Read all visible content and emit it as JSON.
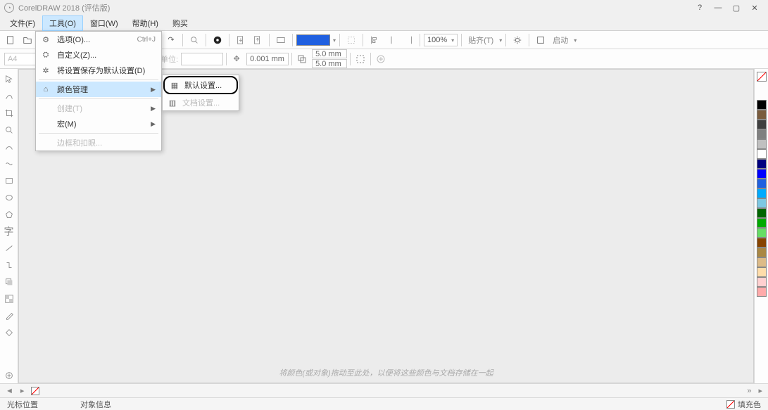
{
  "title": "CorelDRAW 2018 (评估版)",
  "menubar": {
    "items": [
      "文件(F)",
      "工具(O)",
      "窗口(W)",
      "帮助(H)",
      "购买"
    ],
    "open_index": 1
  },
  "dropdown": {
    "options": {
      "label": "选项(O)...",
      "shortcut": "Ctrl+J"
    },
    "customize": "自定义(Z)...",
    "save_defaults": "将设置保存为默认设置(D)",
    "color_mgmt": "颜色管理",
    "create": "创建(T)",
    "macro": "宏(M)",
    "border_and": "边框和扣眼..."
  },
  "submenu": {
    "default_settings": "默认设置...",
    "doc_settings": "文档设置..."
  },
  "toolbar": {
    "pct": "100%",
    "launch": "启动"
  },
  "propbar": {
    "page": "A4",
    "unit_label": "单位:",
    "nudge": "0.001 mm",
    "dup_x": "5.0 mm",
    "dup_y": "5.0 mm"
  },
  "hint": "将颜色(或对象)拖动至此处，以便将这些颜色与文档存储在一起",
  "statusbar": {
    "cursor_pos": "光标位置",
    "obj_info": "对象信息",
    "fill": "填充色"
  },
  "palette_colors": [
    "#000000",
    "#7a5c3e",
    "#404040",
    "#808080",
    "#c0c0c0",
    "#ffffff",
    "#000080",
    "#0000ff",
    "#2060e0",
    "#00aaff",
    "#7ec8e3",
    "#006600",
    "#00aa00",
    "#66dd66",
    "#884400",
    "#aa8844",
    "#ddbb88",
    "#ffddaa",
    "#ffd0d0",
    "#ffaaaa"
  ]
}
